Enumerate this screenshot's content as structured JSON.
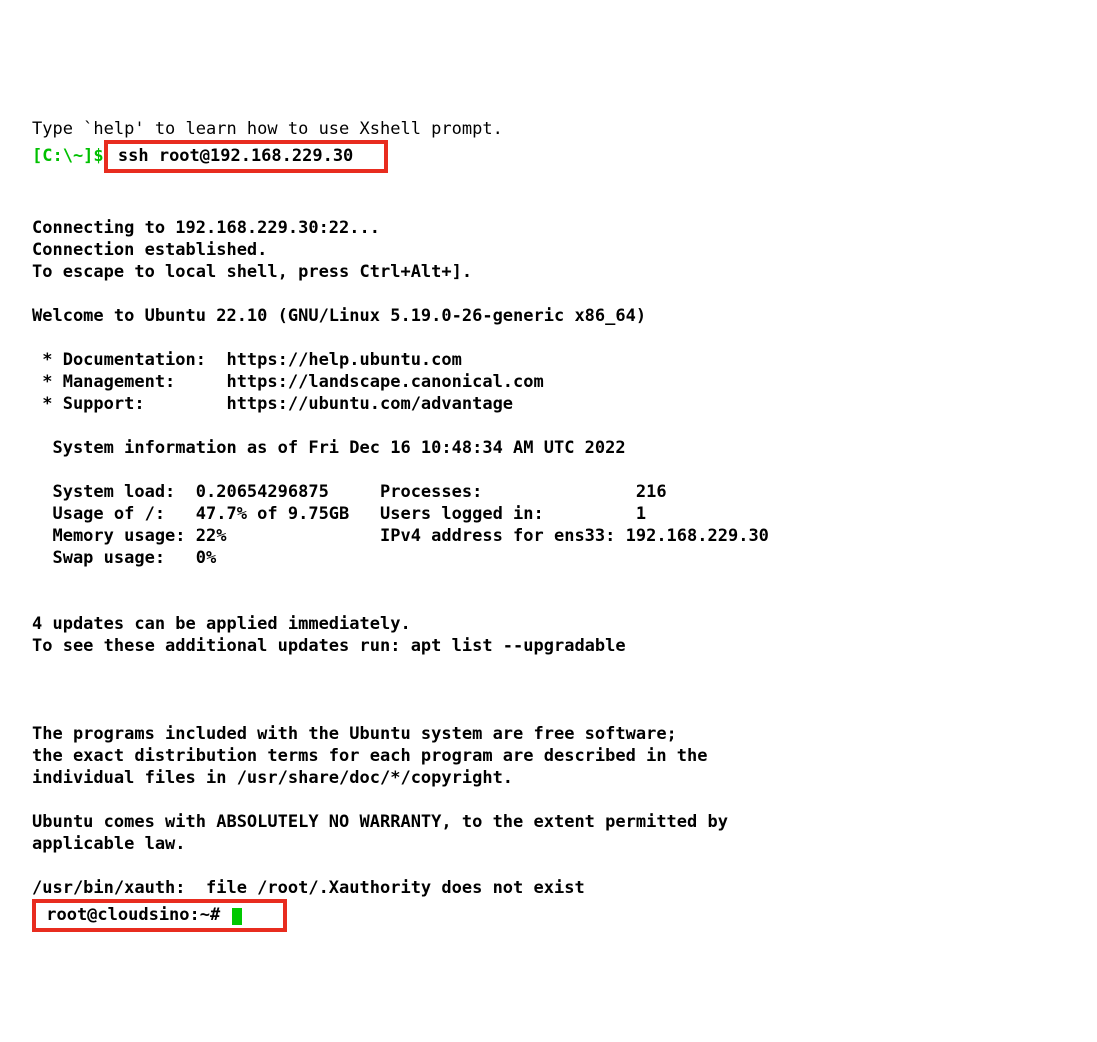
{
  "intro": "Type `help' to learn how to use Xshell prompt.",
  "local_prompt": "[C:\\~]$",
  "ssh_cmd": " ssh root@192.168.229.30   ",
  "conn_a": "Connecting to 192.168.229.30:22...",
  "conn_b": "Connection established.",
  "conn_c": "To escape to local shell, press Ctrl+Alt+].",
  "welcome": "Welcome to Ubuntu 22.10 (GNU/Linux 5.19.0-26-generic x86_64)",
  "doc": " * Documentation:  https://help.ubuntu.com",
  "mgmt": " * Management:     https://landscape.canonical.com",
  "supp": " * Support:        https://ubuntu.com/advantage",
  "sysinfo": "  System information as of Fri Dec 16 10:48:34 AM UTC 2022",
  "r1": "  System load:  0.20654296875     Processes:               216",
  "r2": "  Usage of /:   47.7% of 9.75GB   Users logged in:         1",
  "r3": "  Memory usage: 22%               IPv4 address for ens33: 192.168.229.30",
  "r4": "  Swap usage:   0%",
  "upd1": "4 updates can be applied immediately.",
  "upd2": "To see these additional updates run: apt list --upgradable",
  "legal1": "The programs included with the Ubuntu system are free software;",
  "legal2": "the exact distribution terms for each program are described in the",
  "legal3": "individual files in /usr/share/doc/*/copyright.",
  "legal4": "Ubuntu comes with ABSOLUTELY NO WARRANTY, to the extent permitted by",
  "legal5": "applicable law.",
  "xauth": "/usr/bin/xauth:  file /root/.Xauthority does not exist",
  "remote_prompt": " root@cloudsino:~# "
}
